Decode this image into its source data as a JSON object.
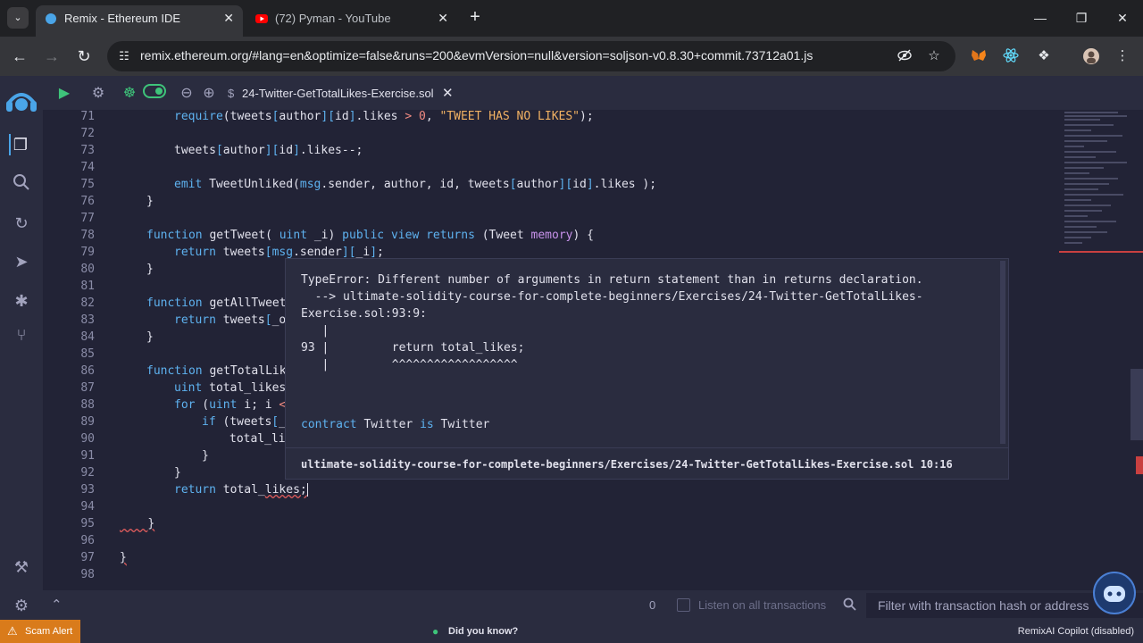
{
  "browser": {
    "tabs": [
      {
        "title": "Remix - Ethereum IDE",
        "active": true
      },
      {
        "title": "(72) Pyman - YouTube",
        "active": false
      }
    ],
    "url_host": "remix.ethereum.org",
    "url_rest": "/#lang=en&optimize=false&runs=200&evmVersion=null&version=soljson-v0.8.30+commit.73712a01.js"
  },
  "editor": {
    "file_tab": "24-Twitter-GetTotalLikes-Exercise.sol",
    "line_numbers": [
      "71",
      "72",
      "73",
      "74",
      "75",
      "76",
      "77",
      "78",
      "79",
      "80",
      "81",
      "82",
      "83",
      "84",
      "85",
      "86",
      "87",
      "88",
      "89",
      "90",
      "91",
      "92",
      "93",
      "94",
      "95",
      "96",
      "97",
      "98"
    ],
    "lines": {
      "l71": "require(tweets[author][id].likes > 0, \"TWEET HAS NO LIKES\");",
      "l73": "tweets[author][id].likes--;",
      "l75": "emit TweetUnliked(msg.sender, author, id, tweets[author][id].likes );",
      "l76": "}",
      "l78": "function getTweet( uint _i) public view returns (Tweet memory) {",
      "l79": "return tweets[msg.sender][_i];",
      "l80": "}",
      "l82": "function getAllTweet",
      "l83": "return tweets[_o",
      "l84": "}",
      "l86": "function getTotalLik",
      "l87": "uint total_likes",
      "l88": "for (uint i; i <",
      "l89": "if (tweets[_",
      "l90": "total_li",
      "l91": "}",
      "l92": "}",
      "l93": "return total_likes;",
      "l95": "}",
      "l97": "}"
    }
  },
  "hover": {
    "error_line1": "TypeError: Different number of arguments in return statement than in returns declaration.",
    "error_line2": "  --> ultimate-solidity-course-for-complete-beginners/Exercises/24-Twitter-GetTotalLikes-",
    "error_line3": "Exercise.sol:93:9:",
    "pipe1": "   |",
    "snippet_line": "93 |         return total_likes;",
    "pipe2": "   |         ^^^^^^^^^^^^^^^^^^",
    "contract_line": "contract Twitter is Twitter",
    "footer": "ultimate-solidity-course-for-complete-beginners/Exercises/24-Twitter-GetTotalLikes-Exercise.sol 10:16"
  },
  "terminal": {
    "count": "0",
    "listen_label": "Listen on all transactions",
    "filter_placeholder": "Filter with transaction hash or address"
  },
  "status": {
    "scam_alert": "Scam Alert",
    "did_you_know": "Did you know?",
    "copilot": "RemixAI Copilot (disabled)"
  },
  "icons": {
    "search": "search-icon",
    "play": "play-icon",
    "settings": "gear-icon"
  },
  "colors": {
    "accent": "#5eb2f0",
    "scam": "#d97b1b",
    "error": "#e05c5c"
  }
}
